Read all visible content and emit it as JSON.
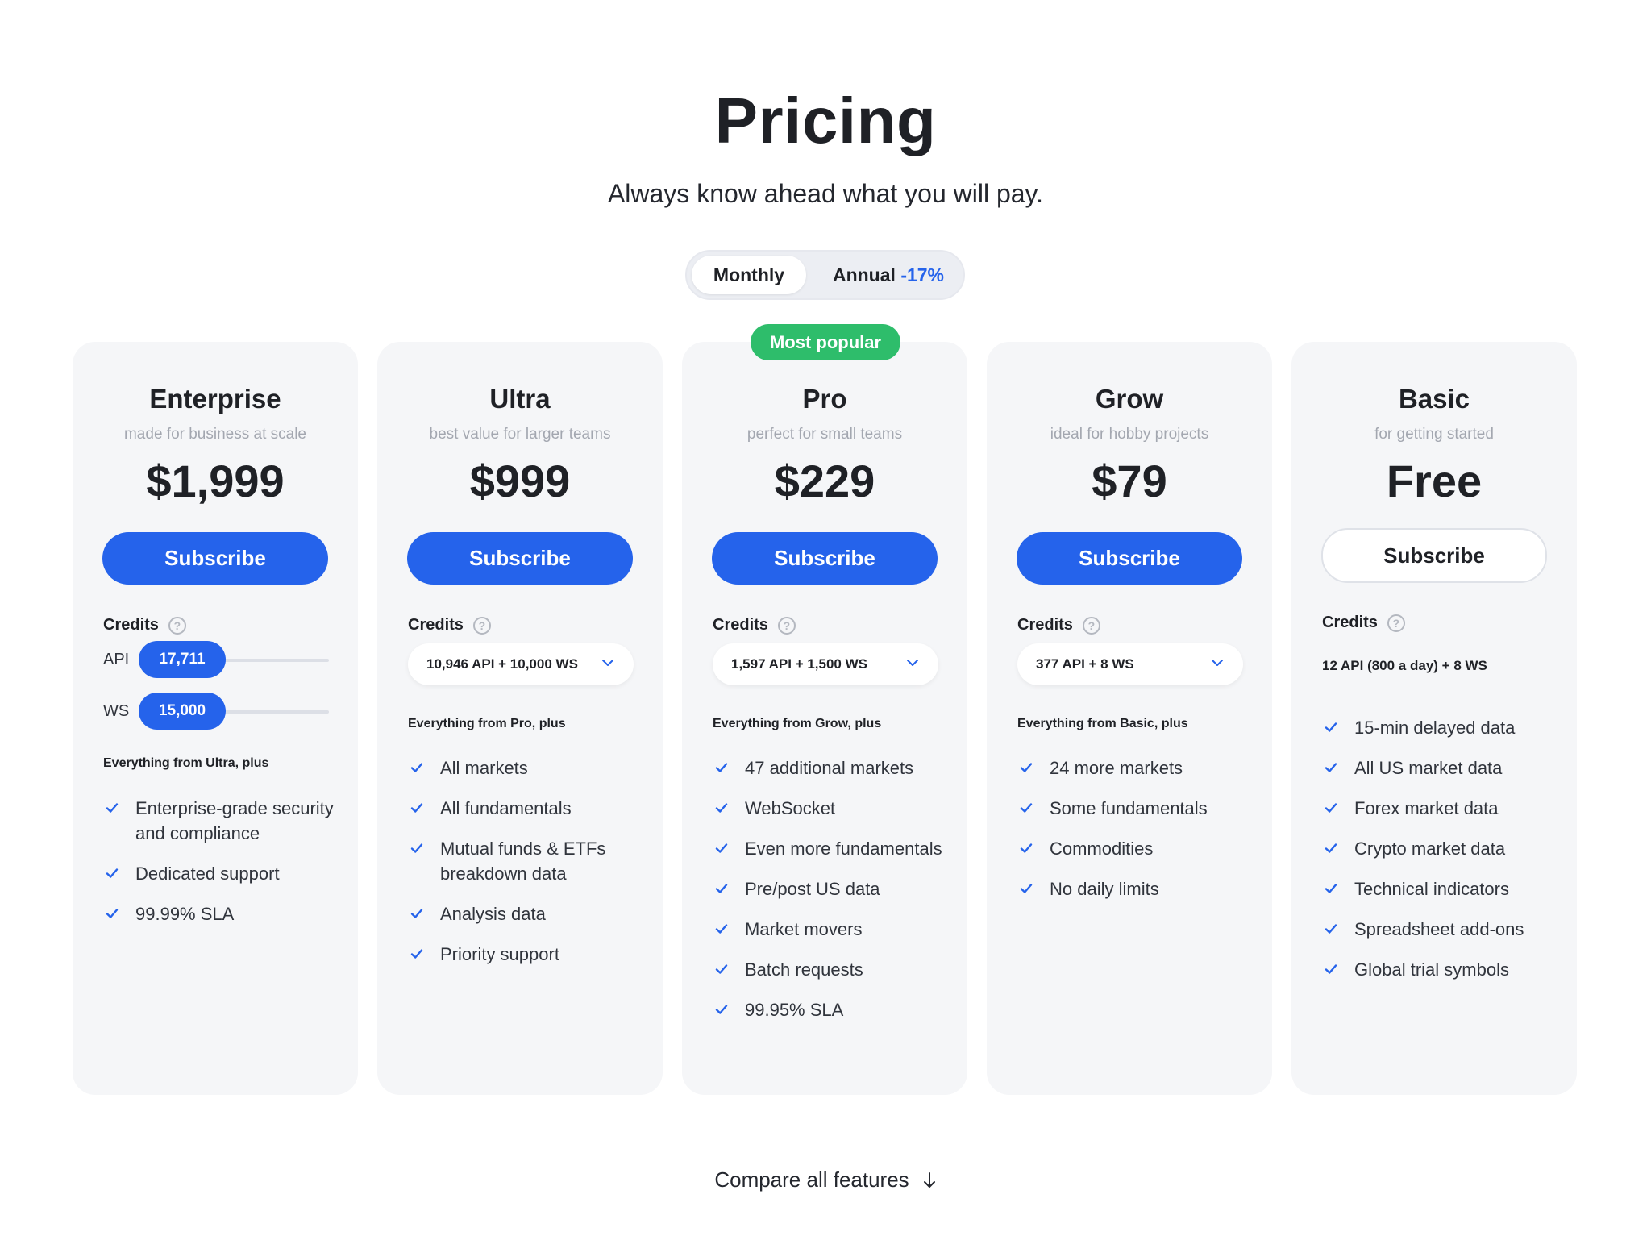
{
  "header": {
    "title": "Pricing",
    "subtitle": "Always know ahead what you will pay."
  },
  "billing_toggle": {
    "monthly_label": "Monthly",
    "annual_label": "Annual",
    "annual_discount": "-17%",
    "selected": "Monthly"
  },
  "popular_badge": "Most popular",
  "colors": {
    "accent": "#2563eb",
    "badge": "#2ebd6b",
    "card_bg": "#f5f6f8"
  },
  "plans": [
    {
      "name": "Enterprise",
      "description": "made for business at scale",
      "price": "$1,999",
      "button": "Subscribe",
      "credits_label": "Credits",
      "credits_help": "?",
      "credits_api_label": "API",
      "credits_api_value": "17,711",
      "credits_ws_label": "WS",
      "credits_ws_value": "15,000",
      "includes": "Everything from Ultra, plus",
      "features": [
        "Enterprise-grade security and compliance",
        "Dedicated support",
        "99.99% SLA"
      ]
    },
    {
      "name": "Ultra",
      "description": "best value for larger teams",
      "price": "$999",
      "button": "Subscribe",
      "credits_label": "Credits",
      "credits_help": "?",
      "credits_select": "10,946 API + 10,000 WS",
      "includes": "Everything from Pro, plus",
      "features": [
        "All markets",
        "All fundamentals",
        "Mutual funds & ETFs breakdown data",
        "Analysis data",
        "Priority support"
      ]
    },
    {
      "name": "Pro",
      "description": "perfect for small teams",
      "price": "$229",
      "button": "Subscribe",
      "credits_label": "Credits",
      "credits_help": "?",
      "credits_select": "1,597 API + 1,500 WS",
      "includes": "Everything from Grow, plus",
      "features": [
        "47 additional markets",
        "WebSocket",
        "Even more fundamentals",
        "Pre/post US data",
        "Market movers",
        "Batch requests",
        "99.95% SLA"
      ]
    },
    {
      "name": "Grow",
      "description": "ideal for hobby projects",
      "price": "$79",
      "button": "Subscribe",
      "credits_label": "Credits",
      "credits_help": "?",
      "credits_select": "377 API + 8 WS",
      "includes": "Everything from Basic, plus",
      "features": [
        "24 more markets",
        "Some fundamentals",
        "Commodities",
        "No daily limits"
      ]
    },
    {
      "name": "Basic",
      "description": "for getting started",
      "price": "Free",
      "button": "Subscribe",
      "credits_label": "Credits",
      "credits_help": "?",
      "credits_text": "12 API (800 a day) + 8 WS",
      "features": [
        "15-min delayed data",
        "All US market data",
        "Forex market data",
        "Crypto market data",
        "Technical indicators",
        "Spreadsheet add-ons",
        "Global trial symbols"
      ]
    }
  ],
  "footer": {
    "compare_label": "Compare all features"
  }
}
